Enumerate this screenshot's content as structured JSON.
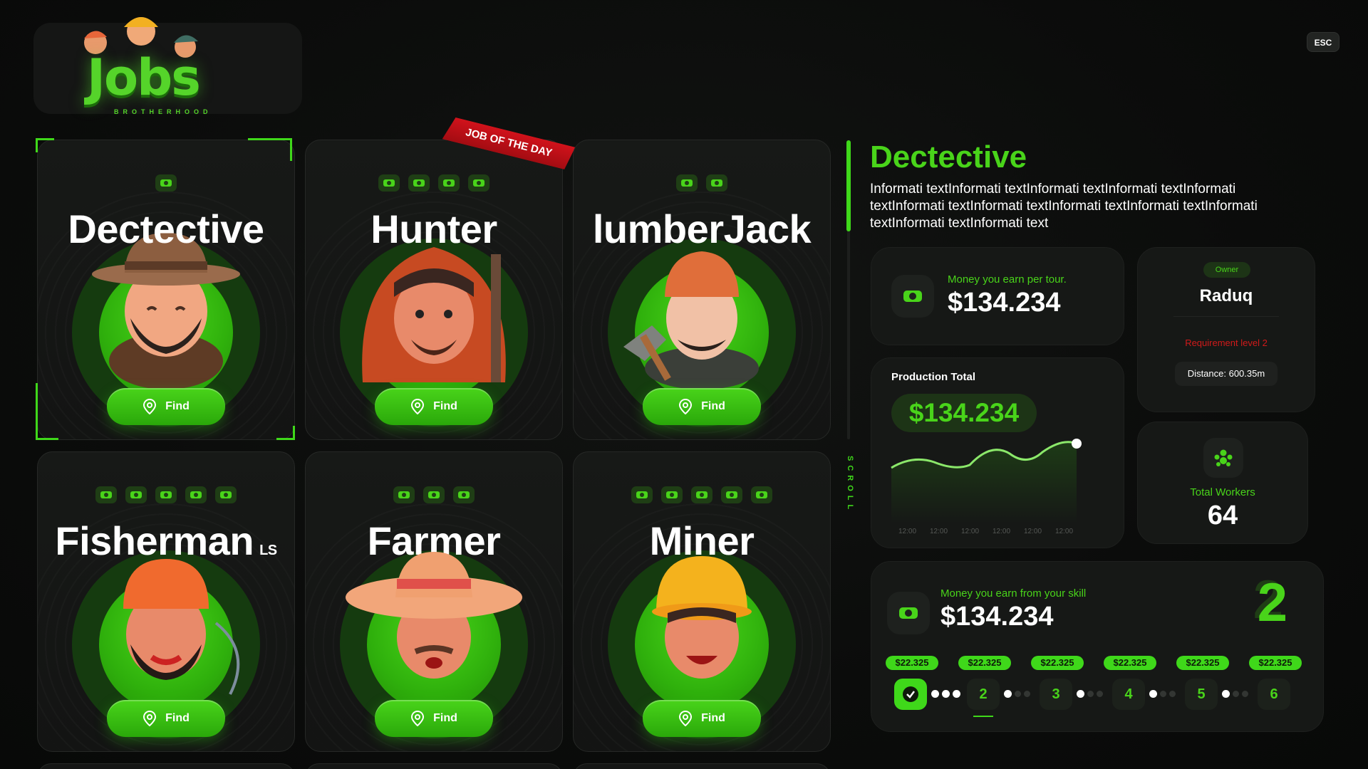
{
  "logo": {
    "word": "Jobs",
    "sub": "BROTHERHOOD"
  },
  "esc_label": "ESC",
  "cards": [
    {
      "title": "Dectective",
      "suffix": "",
      "badges": 1,
      "find_label": "Find",
      "selected": true
    },
    {
      "title": "Hunter",
      "suffix": "",
      "badges": 4,
      "find_label": "Find",
      "selected": false
    },
    {
      "title": "lumberJack",
      "suffix": "",
      "badges": 2,
      "find_label": "Find",
      "selected": false
    },
    {
      "title": "Fisherman",
      "suffix": "LS",
      "badges": 5,
      "find_label": "Find",
      "selected": false
    },
    {
      "title": "Farmer",
      "suffix": "",
      "badges": 3,
      "find_label": "Find",
      "selected": false
    },
    {
      "title": "Miner",
      "suffix": "",
      "badges": 5,
      "find_label": "Find",
      "selected": false
    }
  ],
  "ribbon": "JOB OF THE DAY",
  "scroll_label": "SCROLL",
  "detail": {
    "title": "Dectective",
    "description": "Informati textInformati textInformati textInformati textInformati textInformati textInformati textInformati textInformati textInformati textInformati textInformati text"
  },
  "money_tour": {
    "label": "Money you earn per tour.",
    "value": "$134.234"
  },
  "owner": {
    "chip": "Owner",
    "name": "Raduq",
    "requirement": "Requirement level 2",
    "distance": "Distance: 600.35m"
  },
  "production": {
    "label": "Production Total",
    "value": "$134.234",
    "x_labels": [
      "12:00",
      "12:00",
      "12:00",
      "12:00",
      "12:00",
      "12:00"
    ]
  },
  "workers": {
    "label": "Total Workers",
    "value": "64"
  },
  "skill": {
    "label": "Money you earn from your skill",
    "value": "$134.234",
    "current_level": "2",
    "levels": [
      {
        "label": "",
        "price": "$22.325",
        "active": true
      },
      {
        "label": "2",
        "price": "$22.325",
        "active": false
      },
      {
        "label": "3",
        "price": "$22.325",
        "active": false
      },
      {
        "label": "4",
        "price": "$22.325",
        "active": false
      },
      {
        "label": "5",
        "price": "$22.325",
        "active": false
      },
      {
        "label": "6",
        "price": "$22.325",
        "active": false
      }
    ]
  },
  "colors": {
    "accent": "#3fd81a",
    "danger": "#d11a1a",
    "bg": "#0b0c0b"
  }
}
